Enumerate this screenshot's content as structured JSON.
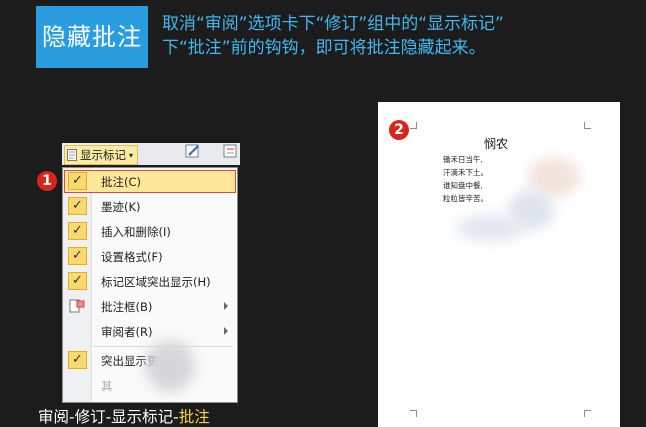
{
  "header": {
    "badge": "隐藏批注",
    "desc_line1": "取消“审阅”选项卡下“修订”组中的“显示标记”",
    "desc_line2": "下“批注”前的钩钩，即可将批注隐藏起来。"
  },
  "ribbon": {
    "button_label": "显示标记",
    "caret": "▾"
  },
  "menu": {
    "items": [
      {
        "label": "批注(C)",
        "checked": true
      },
      {
        "label": "墨迹(K)",
        "checked": true
      },
      {
        "label": "插入和删除(I)",
        "checked": true
      },
      {
        "label": "设置格式(F)",
        "checked": true
      },
      {
        "label": "标记区域突出显示(H)",
        "checked": true
      },
      {
        "label": "批注框(B)",
        "submenu": true
      },
      {
        "label": "审阅者(R)",
        "submenu": true
      },
      {
        "label": "突出显示更",
        "checked": true
      },
      {
        "label": "其",
        "disabled": true
      }
    ],
    "check_glyph": "✓"
  },
  "steps": {
    "one": "1",
    "two": "2"
  },
  "caption": {
    "prefix": "审阅-修订-显示标记-",
    "highlight": "批注"
  },
  "document": {
    "title": "悯农",
    "lines": [
      "锄禾日当午,",
      "汗滴禾下土。",
      "谁知盘中餐,",
      "粒粒皆辛苦。"
    ]
  },
  "colors": {
    "badge": "#2a9de0",
    "desc": "#41b7f0",
    "highlight": "#ffd23a",
    "step": "#d9261c"
  }
}
